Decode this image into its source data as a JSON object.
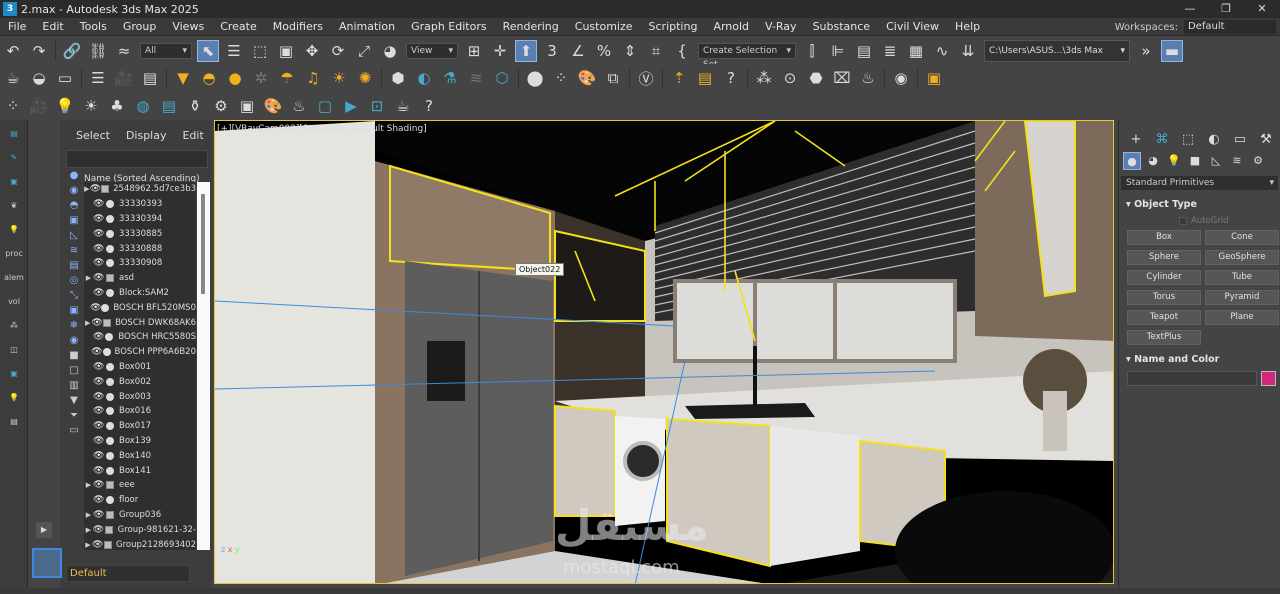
{
  "window": {
    "title": "2.max - Autodesk 3ds Max 2025",
    "minimize": "—",
    "maximize": "❐",
    "close": "✕"
  },
  "menu": [
    "File",
    "Edit",
    "Tools",
    "Group",
    "Views",
    "Create",
    "Modifiers",
    "Animation",
    "Graph Editors",
    "Rendering",
    "Customize",
    "Scripting",
    "Arnold",
    "V-Ray",
    "Substance",
    "Civil View",
    "Help"
  ],
  "workspaces": {
    "label": "Workspaces:",
    "value": "Default"
  },
  "toolbar": {
    "selection_filter": "All",
    "ref_coord": "View",
    "selection_set": "Create Selection Set",
    "project_path": "C:\\Users\\ASUS...\\3ds Max 2025"
  },
  "left_strip": {
    "proc": "proc",
    "alem": "alem",
    "vol": "vol"
  },
  "scene_explorer": {
    "tabs": [
      "Select",
      "Display",
      "Edit"
    ],
    "column_header": "Name (Sorted Ascending)",
    "rows": [
      {
        "name": "2548962.5d7ce3b3",
        "type": "group",
        "expand": true
      },
      {
        "name": "33330393",
        "type": "object",
        "expand": false
      },
      {
        "name": "33330394",
        "type": "object",
        "expand": false
      },
      {
        "name": "33330885",
        "type": "object",
        "expand": false
      },
      {
        "name": "33330888",
        "type": "object",
        "expand": false
      },
      {
        "name": "33330908",
        "type": "object",
        "expand": false
      },
      {
        "name": "asd",
        "type": "group",
        "expand": true
      },
      {
        "name": "Block:SAM2",
        "type": "object",
        "expand": false
      },
      {
        "name": "BOSCH BFL520MS0",
        "type": "object",
        "expand": false
      },
      {
        "name": "BOSCH DWK68AK6",
        "type": "group",
        "expand": true
      },
      {
        "name": "BOSCH HRC5580S",
        "type": "object",
        "expand": false
      },
      {
        "name": "BOSCH PPP6A6B20",
        "type": "object",
        "expand": false
      },
      {
        "name": "Box001",
        "type": "object",
        "expand": false
      },
      {
        "name": "Box002",
        "type": "object",
        "expand": false
      },
      {
        "name": "Box003",
        "type": "object",
        "expand": false
      },
      {
        "name": "Box016",
        "type": "object",
        "expand": false
      },
      {
        "name": "Box017",
        "type": "object",
        "expand": false
      },
      {
        "name": "Box139",
        "type": "object",
        "expand": false
      },
      {
        "name": "Box140",
        "type": "object",
        "expand": false
      },
      {
        "name": "Box141",
        "type": "object",
        "expand": false
      },
      {
        "name": "eee",
        "type": "group",
        "expand": true
      },
      {
        "name": "floor",
        "type": "object",
        "expand": false
      },
      {
        "name": "Group036",
        "type": "group",
        "expand": true
      },
      {
        "name": "Group-981621-32-",
        "type": "group",
        "expand": true
      },
      {
        "name": "Group2128693402",
        "type": "group",
        "expand": true
      }
    ],
    "layer": "Default"
  },
  "viewport": {
    "label": "[+][VRayCam002][Standard][Default Shading]",
    "tooltip": "Object022",
    "watermark_ar": "مستقل",
    "watermark_en": "mostaql.com",
    "axis_x": "x",
    "axis_y": "y",
    "axis_z": "z"
  },
  "command_panel": {
    "category": "Standard Primitives",
    "object_type_title": "Object Type",
    "autogrid": "AutoGrid",
    "primitives": [
      "Box",
      "Cone",
      "Sphere",
      "GeoSphere",
      "Cylinder",
      "Tube",
      "Torus",
      "Pyramid",
      "Teapot",
      "Plane",
      "TextPlus"
    ],
    "name_color_title": "Name and Color",
    "object_color": "#d0287a"
  }
}
